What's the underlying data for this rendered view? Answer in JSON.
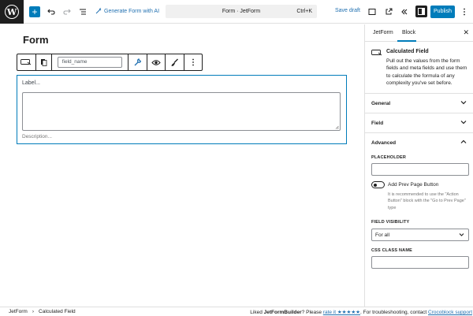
{
  "toolbar": {
    "add_block_icon": "plus-icon",
    "generate_ai_label": "Generate Form with AI",
    "document_title": "Form · JetForm",
    "shortcut": "Ctrl+K",
    "save_draft_label": "Save draft",
    "publish_label": "Publish",
    "accent_color": "#007cba"
  },
  "editor": {
    "post_title": "Form",
    "block_toolbar": {
      "field_name_value": "field_name"
    },
    "field": {
      "label_placeholder": "Label...",
      "description_placeholder": "Description..."
    }
  },
  "sidebar": {
    "tabs": [
      "JetForm",
      "Block"
    ],
    "active_tab": "Block",
    "block_card": {
      "title": "Calculated Field",
      "description": "Pull out the values from the form fields and meta fields and use them to calculate the formula of any complexity you've set before."
    },
    "panels": {
      "general": "General",
      "field": "Field",
      "advanced": "Advanced"
    },
    "advanced": {
      "placeholder_label": "PLACEHOLDER",
      "placeholder_value": "",
      "prev_page_toggle_label": "Add Prev Page Button",
      "prev_page_help": "It is recommended to use the \"Action Button\" block with the \"Go to Prev Page\" type",
      "visibility_label": "FIELD VISIBILITY",
      "visibility_value": "For all",
      "css_class_label": "CSS CLASS NAME",
      "css_class_value": ""
    }
  },
  "footer": {
    "breadcrumb": [
      "JetForm",
      "Calculated Field"
    ],
    "liked_prefix": "Liked ",
    "liked_product": "JetFormBuilder",
    "please_text": "? Please ",
    "rate_link": "rate it ★★★★★",
    "trouble_text": ". For troubleshooting, contact ",
    "support_link": "Crocoblock support"
  }
}
